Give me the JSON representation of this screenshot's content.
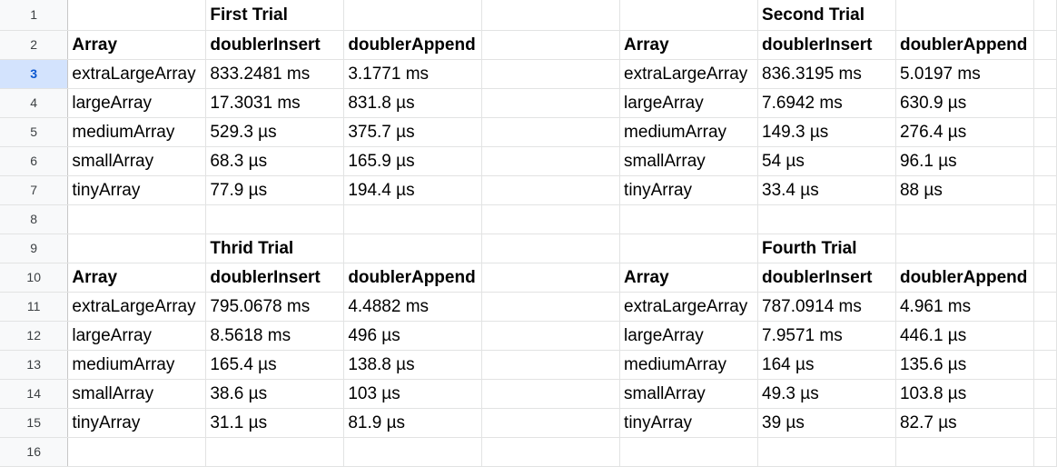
{
  "row_numbers": [
    "1",
    "2",
    "3",
    "4",
    "5",
    "6",
    "7",
    "8",
    "9",
    "10",
    "11",
    "12",
    "13",
    "14",
    "15",
    "16"
  ],
  "selected_row": "3",
  "first": {
    "title": "First Trial",
    "headers": [
      "Array",
      "doublerInsert",
      "doublerAppend"
    ],
    "rows": [
      [
        "extraLargeArray",
        "833.2481 ms",
        "3.1771 ms"
      ],
      [
        "largeArray",
        "17.3031 ms",
        "831.8 µs"
      ],
      [
        "mediumArray",
        "529.3 µs",
        "375.7 µs"
      ],
      [
        "smallArray",
        "68.3 µs",
        "165.9 µs"
      ],
      [
        "tinyArray",
        "77.9 µs",
        "194.4 µs"
      ]
    ]
  },
  "second": {
    "title": "Second Trial",
    "headers": [
      "Array",
      "doublerInsert",
      "doublerAppend"
    ],
    "rows": [
      [
        "extraLargeArray",
        "836.3195 ms",
        "5.0197 ms"
      ],
      [
        "largeArray",
        "7.6942 ms",
        "630.9 µs"
      ],
      [
        "mediumArray",
        "149.3 µs",
        "276.4 µs"
      ],
      [
        "smallArray",
        "54 µs",
        "96.1 µs"
      ],
      [
        "tinyArray",
        "33.4 µs",
        "88 µs"
      ]
    ]
  },
  "third": {
    "title": "Thrid Trial",
    "headers": [
      "Array",
      "doublerInsert",
      "doublerAppend"
    ],
    "rows": [
      [
        "extraLargeArray",
        "795.0678 ms",
        "4.4882 ms"
      ],
      [
        "largeArray",
        "8.5618 ms",
        "496 µs"
      ],
      [
        "mediumArray",
        "165.4 µs",
        "138.8 µs"
      ],
      [
        "smallArray",
        "38.6 µs",
        "103 µs"
      ],
      [
        "tinyArray",
        "31.1 µs",
        "81.9 µs"
      ]
    ]
  },
  "fourth": {
    "title": "Fourth Trial",
    "headers": [
      "Array",
      "doublerInsert",
      "doublerAppend"
    ],
    "rows": [
      [
        "extraLargeArray",
        "787.0914 ms",
        "4.961 ms"
      ],
      [
        "largeArray",
        "7.9571 ms",
        "446.1 µs"
      ],
      [
        "mediumArray",
        "164 µs",
        "135.6 µs"
      ],
      [
        "smallArray",
        "49.3 µs",
        "103.8 µs"
      ],
      [
        "tinyArray",
        "39 µs",
        "82.7 µs"
      ]
    ]
  },
  "colors": {
    "gridline": "#e2e3e3",
    "header_bg": "#f8f9fa",
    "selected_header_bg": "#d3e3fd",
    "selected_header_text": "#0b57d0"
  }
}
